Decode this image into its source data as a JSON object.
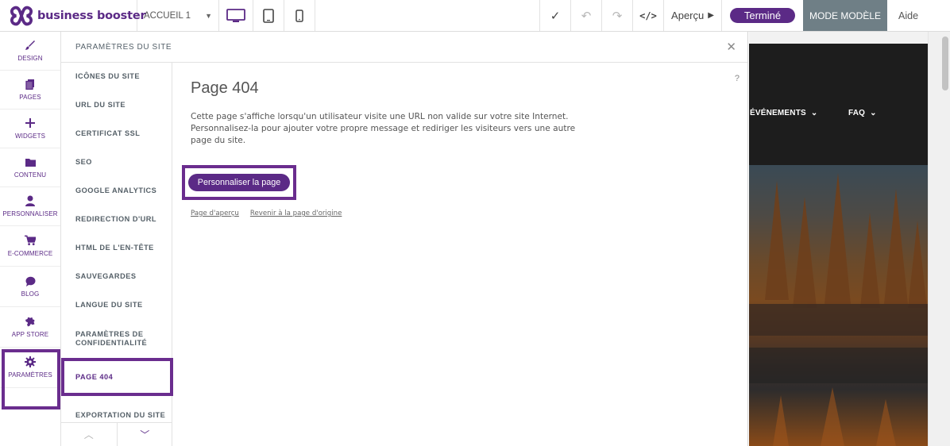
{
  "topbar": {
    "brand": "business booster",
    "page_select": "ACCUEIL 1",
    "preview_label": "Aperçu",
    "done_label": "Terminé",
    "mode_label": "MODE MODÈLE",
    "help_label": "Aide",
    "accent_color": "#5b2a86"
  },
  "sidebar": {
    "items": [
      {
        "label": "DESIGN",
        "icon": "brush-icon"
      },
      {
        "label": "PAGES",
        "icon": "pages-icon"
      },
      {
        "label": "WIDGETS",
        "icon": "plus-icon"
      },
      {
        "label": "CONTENU",
        "icon": "folder-icon"
      },
      {
        "label": "PERSONNALISER",
        "icon": "user-icon"
      },
      {
        "label": "E-COMMERCE",
        "icon": "cart-icon"
      },
      {
        "label": "BLOG",
        "icon": "chat-icon"
      },
      {
        "label": "APP STORE",
        "icon": "puzzle-icon"
      },
      {
        "label": "PARAMÈTRES",
        "icon": "gear-icon"
      }
    ]
  },
  "panel": {
    "title": "PARAMÈTRES DU SITE",
    "menu": [
      "ICÔNES DU SITE",
      "URL DU SITE",
      "CERTIFICAT SSL",
      "SEO",
      "GOOGLE ANALYTICS",
      "REDIRECTION D'URL",
      "HTML DE L'EN-TÊTE",
      "SAUVEGARDES",
      "LANGUE DU SITE",
      "PARAMÈTRES DE CONFIDENTIALITÉ",
      "PAGE 404",
      "EXPORTATION DU SITE"
    ],
    "active_menu": "PAGE 404",
    "help": "?"
  },
  "content": {
    "title": "Page 404",
    "description": "Cette page s'affiche lorsqu'un utilisateur visite une URL non valide sur votre site Internet. Personnalisez-la pour ajouter votre propre message et rediriger les visiteurs vers une autre page du site.",
    "cta_label": "Personnaliser la page",
    "link_preview": "Page d'aperçu",
    "link_revert": "Revenir à la page d'origine"
  },
  "site_preview": {
    "nav": [
      "ÉVÉNEMENTS",
      "FAQ"
    ]
  }
}
